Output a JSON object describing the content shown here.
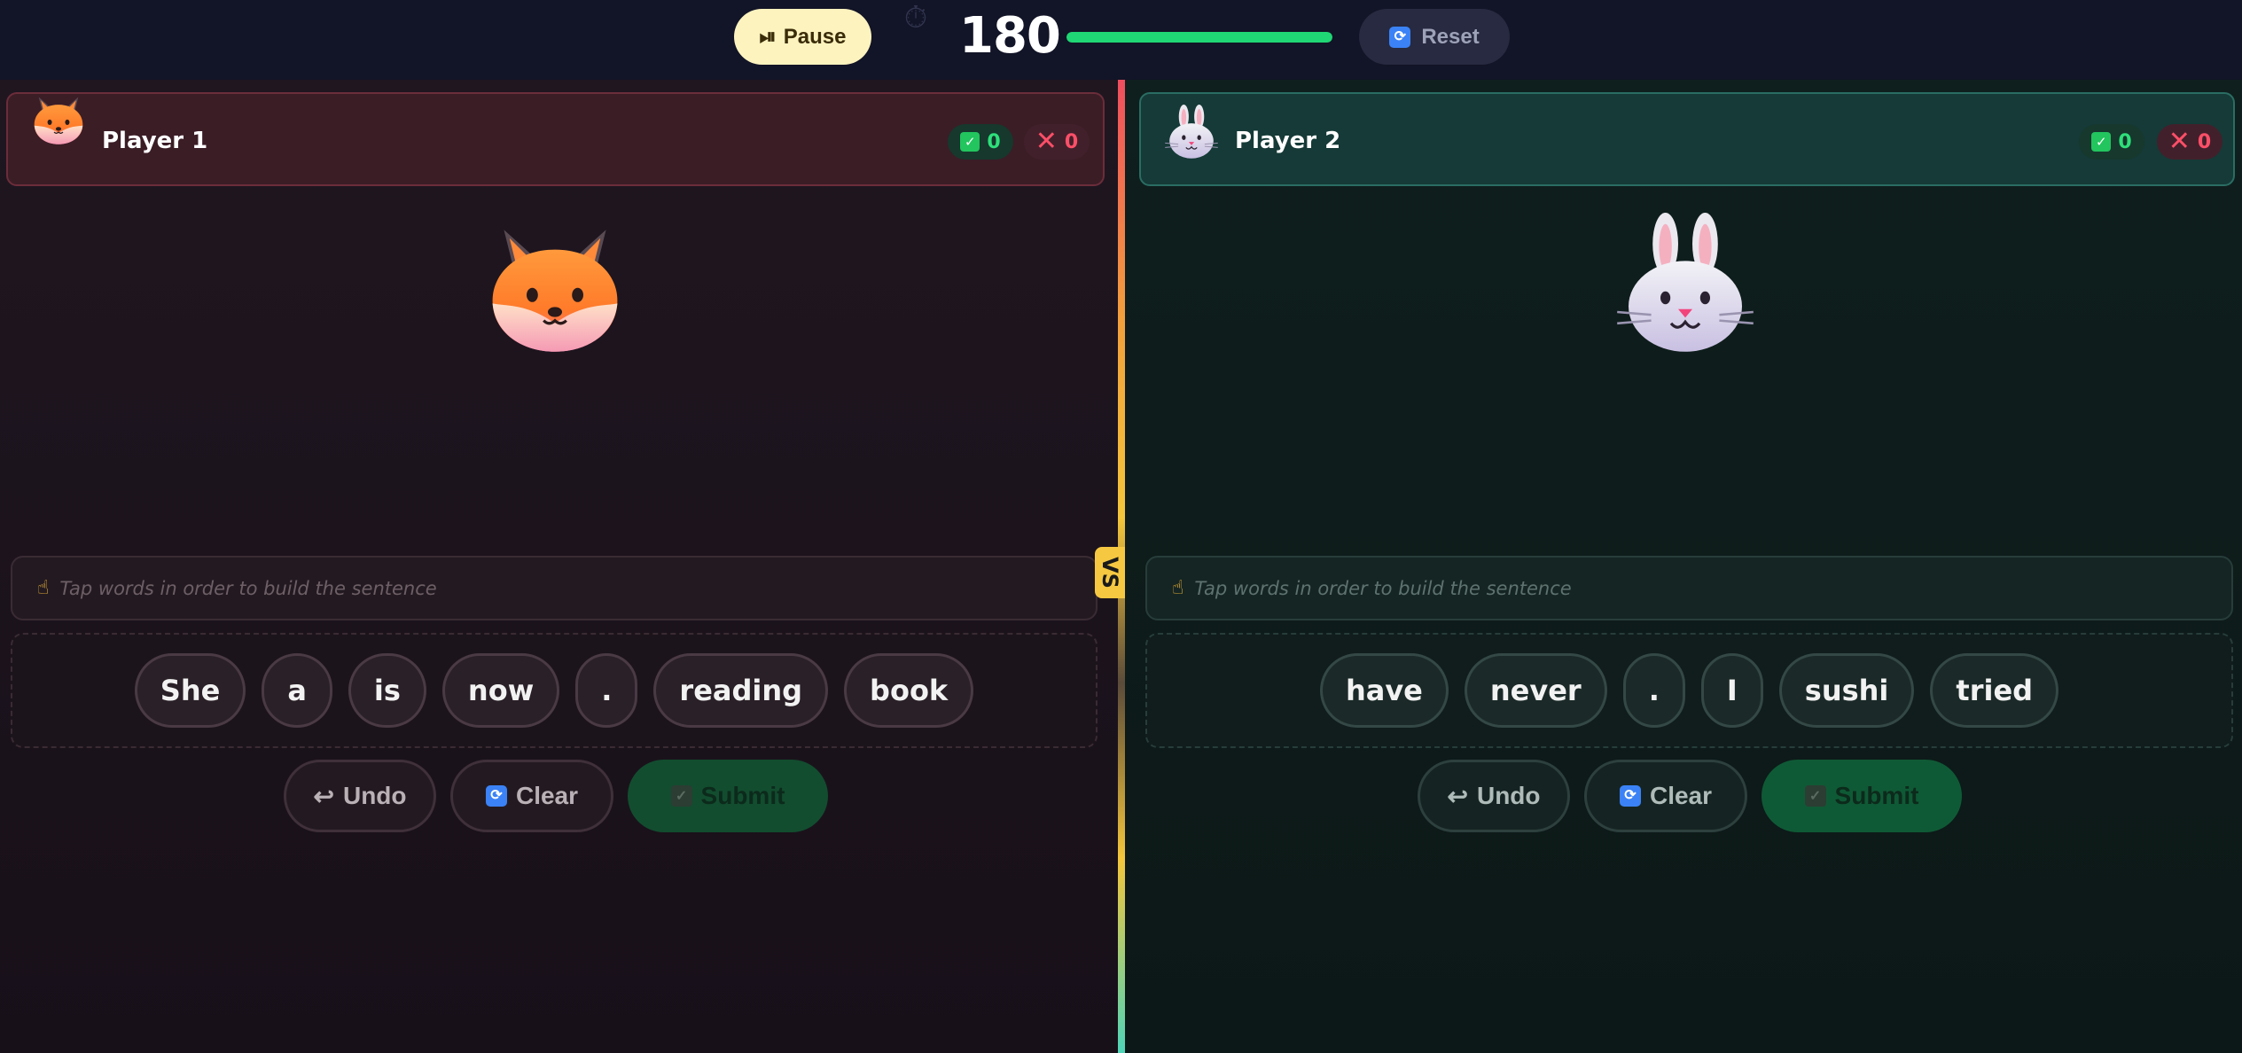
{
  "topbar": {
    "pause_label": "Pause",
    "pause_icon": "⏯",
    "timer_icon": "stopwatch-icon",
    "timer_value": "180",
    "timer_progress": 1.0,
    "timer_color": "#1fd774",
    "reset_label": "Reset",
    "reset_icon": "🔄"
  },
  "vs_label": "VS",
  "players": [
    {
      "name": "Player 1",
      "avatar": "fox-face-icon",
      "correct": "0",
      "wrong": "0",
      "placeholder": "Tap words in order to build the sentence",
      "words": [
        "She",
        "a",
        "is",
        "now",
        ".",
        "reading",
        "book"
      ],
      "undo_label": "Undo",
      "clear_label": "Clear",
      "submit_label": "Submit",
      "theme_color": "#3b1d26"
    },
    {
      "name": "Player 2",
      "avatar": "rabbit-face-icon",
      "correct": "0",
      "wrong": "0",
      "placeholder": "Tap words in order to build the sentence",
      "words": [
        "have",
        "never",
        ".",
        "I",
        "sushi",
        "tried"
      ],
      "undo_label": "Undo",
      "clear_label": "Clear",
      "submit_label": "Submit",
      "theme_color": "#153a37"
    }
  ],
  "colors": {
    "correct": "#2ee07a",
    "wrong": "#ff4f68",
    "vs_badge": "#f6c842",
    "pause_bg": "#fdf3bf"
  }
}
